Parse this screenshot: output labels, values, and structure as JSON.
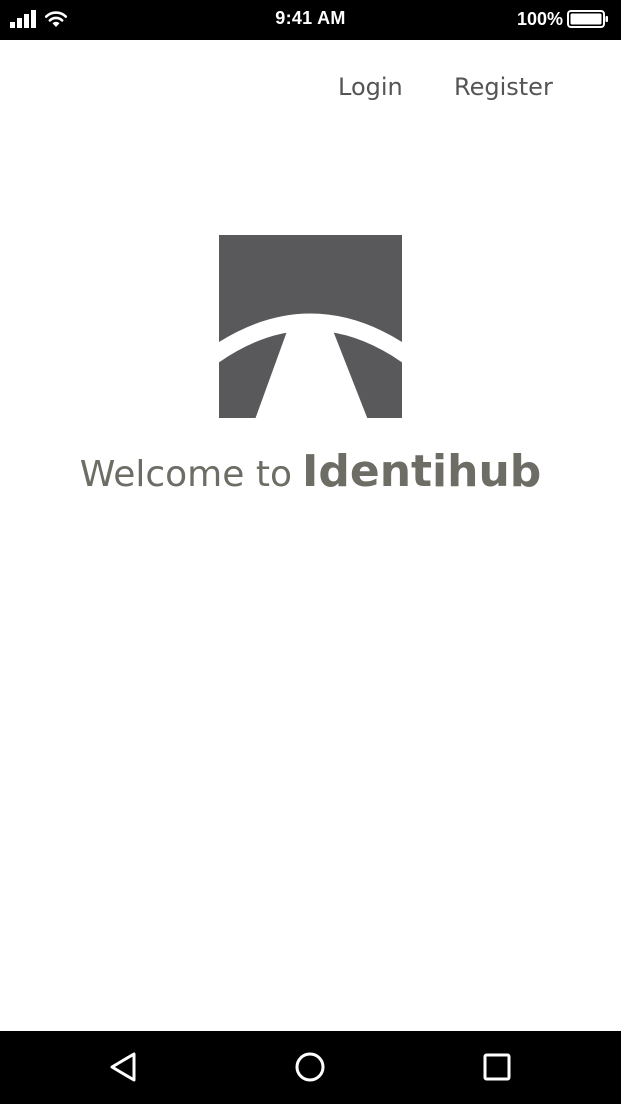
{
  "status_bar": {
    "time": "9:41 AM",
    "battery_percent": "100%",
    "battery_level": 1.0,
    "icons": [
      "cellular-signal-icon",
      "wifi-icon",
      "battery-icon"
    ]
  },
  "header": {
    "login_label": "Login",
    "register_label": "Register"
  },
  "brand": {
    "logo_icon": "identihub-logo-icon",
    "welcome_prefix": "Welcome to",
    "brand_name": "Identihub"
  },
  "colors": {
    "logo_fill": "#59595b",
    "welcome_text": "#6d6d65",
    "nav_link_text": "#555556",
    "system_bars": "#000000"
  },
  "android_nav": {
    "icons": [
      "back-icon",
      "home-icon",
      "recent-apps-icon"
    ]
  }
}
